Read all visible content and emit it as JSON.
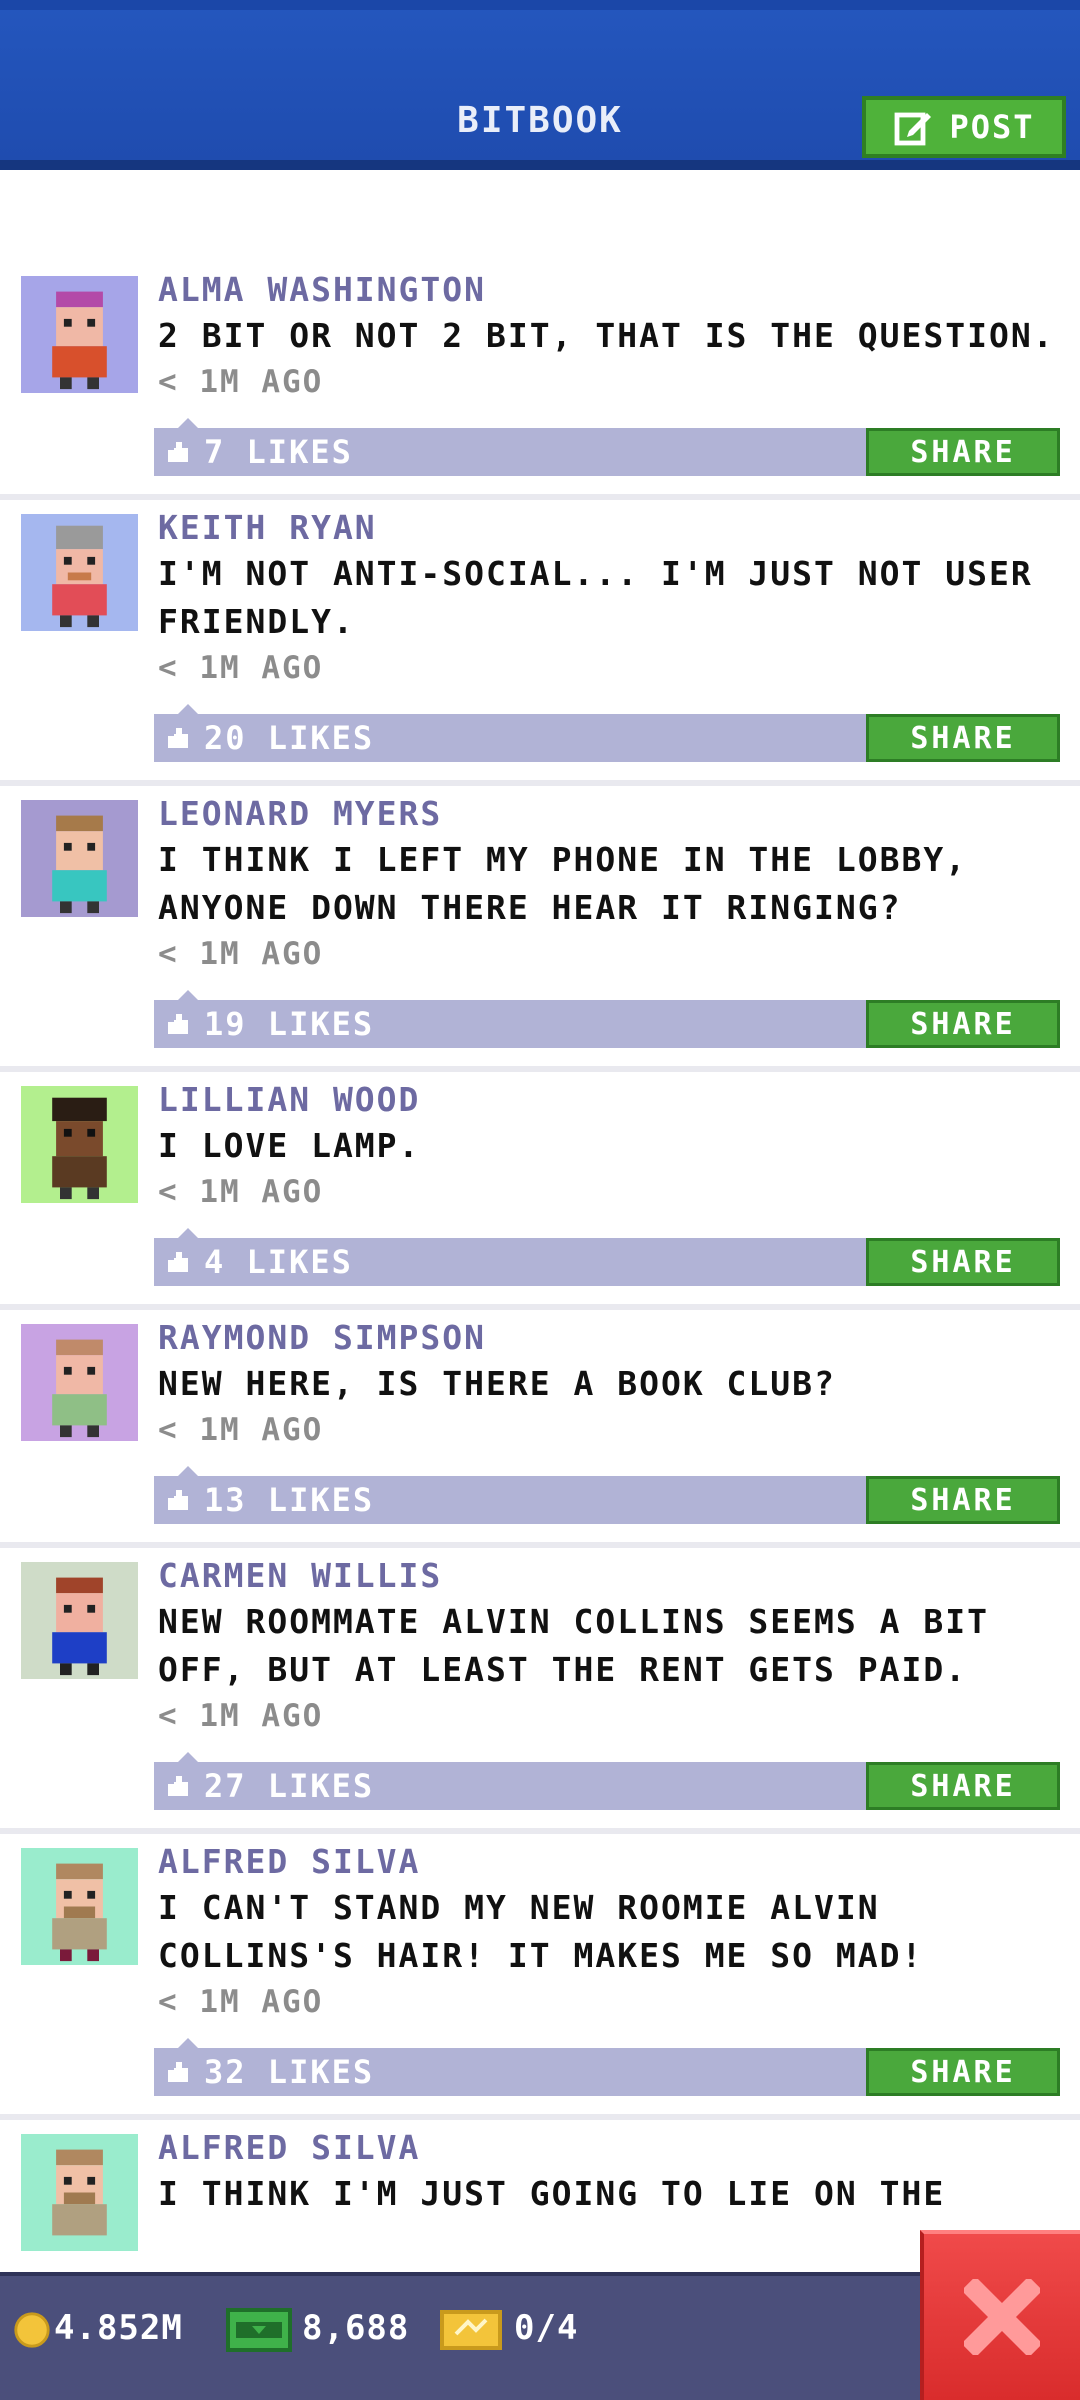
{
  "header": {
    "title": "BITBOOK",
    "post_label": "POST"
  },
  "posts": [
    {
      "name": "ALMA WASHINGTON",
      "text": "2 BIT OR NOT 2 BIT, THAT IS THE QUESTION.",
      "time": "< 1M AGO",
      "likes": "7 LIKES",
      "share": "SHARE",
      "avatar": "#a6a5e8"
    },
    {
      "name": "KEITH RYAN",
      "text": "I'M NOT ANTI-SOCIAL... I'M JUST NOT USER FRIENDLY.",
      "time": "< 1M AGO",
      "likes": "20 LIKES",
      "share": "SHARE",
      "avatar": "#a5b7ef"
    },
    {
      "name": "LEONARD MYERS",
      "text": "I THINK I LEFT MY PHONE IN THE LOBBY, ANYONE DOWN THERE HEAR IT RINGING?",
      "time": "< 1M AGO",
      "likes": "19 LIKES",
      "share": "SHARE",
      "avatar": "#a59ad0"
    },
    {
      "name": "LILLIAN WOOD",
      "text": "I LOVE LAMP.",
      "time": "< 1M AGO",
      "likes": "4 LIKES",
      "share": "SHARE",
      "avatar": "#b3ef8e"
    },
    {
      "name": "RAYMOND SIMPSON",
      "text": "NEW HERE, IS THERE A BOOK CLUB?",
      "time": "< 1M AGO",
      "likes": "13 LIKES",
      "share": "SHARE",
      "avatar": "#c8a3e3"
    },
    {
      "name": "CARMEN WILLIS",
      "text": "NEW ROOMMATE ALVIN COLLINS SEEMS A BIT OFF, BUT AT LEAST THE RENT GETS PAID.",
      "time": "< 1M AGO",
      "likes": "27 LIKES",
      "share": "SHARE",
      "avatar": "#cfdcc8"
    },
    {
      "name": "ALFRED SILVA",
      "text": "I CAN'T STAND MY NEW ROOMIE ALVIN COLLINS'S HAIR! IT MAKES ME SO MAD!",
      "time": "< 1M AGO",
      "likes": "32 LIKES",
      "share": "SHARE",
      "avatar": "#9aeccd"
    },
    {
      "name": "ALFRED SILVA",
      "text": "I THINK I'M JUST GOING TO LIE ON THE",
      "time": "",
      "likes": "",
      "share": "",
      "avatar": "#9aeccd"
    }
  ],
  "status": {
    "coins": "4.852M",
    "bux": "8,688",
    "tickets": "0/4"
  }
}
